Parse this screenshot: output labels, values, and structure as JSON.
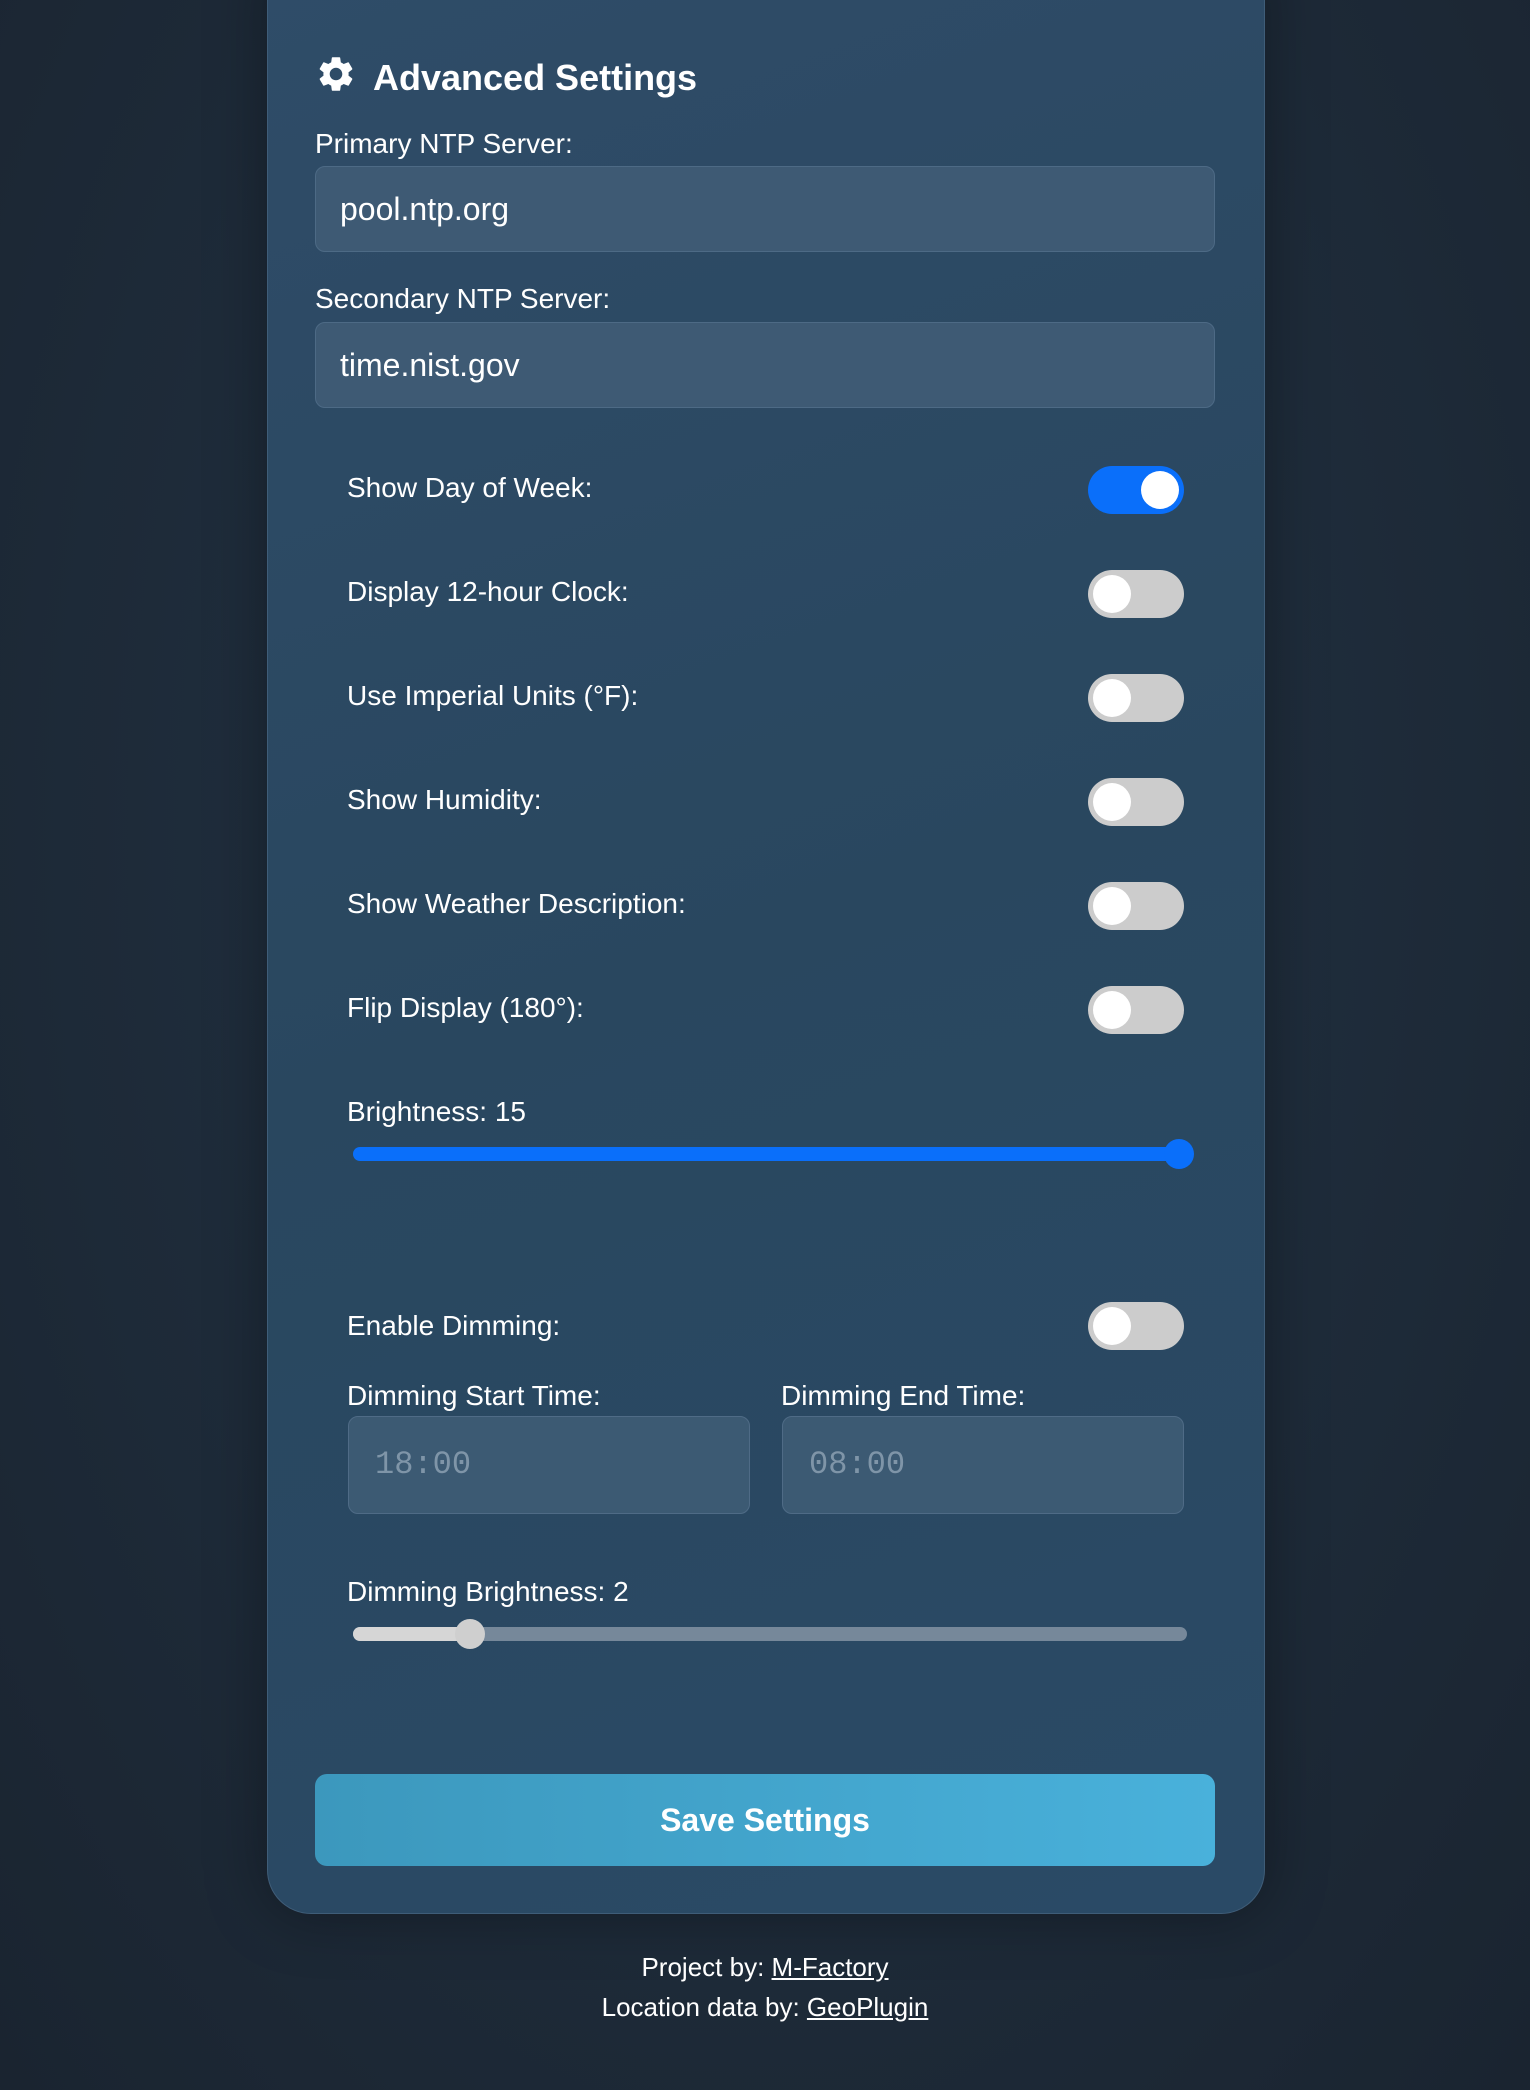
{
  "header": {
    "title": "Advanced Settings",
    "icon": "gear-icon"
  },
  "ntp": {
    "primary_label": "Primary NTP Server:",
    "primary_value": "pool.ntp.org",
    "secondary_label": "Secondary NTP Server:",
    "secondary_value": "time.nist.gov"
  },
  "toggles": {
    "day_of_week": {
      "label": "Show Day of Week:",
      "on": true
    },
    "clock_12h": {
      "label": "Display 12-hour Clock:",
      "on": false
    },
    "imperial": {
      "label": "Use Imperial Units (°F):",
      "on": false
    },
    "humidity": {
      "label": "Show Humidity:",
      "on": false
    },
    "weather_desc": {
      "label": "Show Weather Description:",
      "on": false
    },
    "flip": {
      "label": "Flip Display (180°):",
      "on": false
    },
    "dimming": {
      "label": "Enable Dimming:",
      "on": false
    }
  },
  "brightness": {
    "label": "Brightness: 15",
    "value": 15,
    "min": 0,
    "max": 15
  },
  "dimming": {
    "start_label": "Dimming Start Time:",
    "start_value": "18:00",
    "end_label": "Dimming End Time:",
    "end_value": "08:00",
    "brightness_label": "Dimming Brightness: 2",
    "brightness_value": 2,
    "brightness_min": 0,
    "brightness_max": 15
  },
  "save_label": "Save Settings",
  "footer": {
    "project_prefix": "Project by:",
    "project_link": "M-Factory",
    "location_prefix": "Location data by:",
    "location_link": "GeoPlugin"
  },
  "colors": {
    "accent": "#0a6ffa",
    "toggle_off": "#cccccc",
    "save_button": "#44a6cf"
  }
}
